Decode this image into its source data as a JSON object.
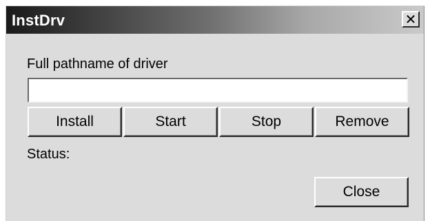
{
  "window": {
    "title": "InstDrv",
    "close_glyph": "✕",
    "close_icon": "close-icon"
  },
  "driver_path": {
    "label": "Full pathname of driver",
    "value": ""
  },
  "actions": {
    "install_label": "Install",
    "start_label": "Start",
    "stop_label": "Stop",
    "remove_label": "Remove"
  },
  "status": {
    "label": "Status:",
    "value": ""
  },
  "footer": {
    "close_label": "Close"
  }
}
